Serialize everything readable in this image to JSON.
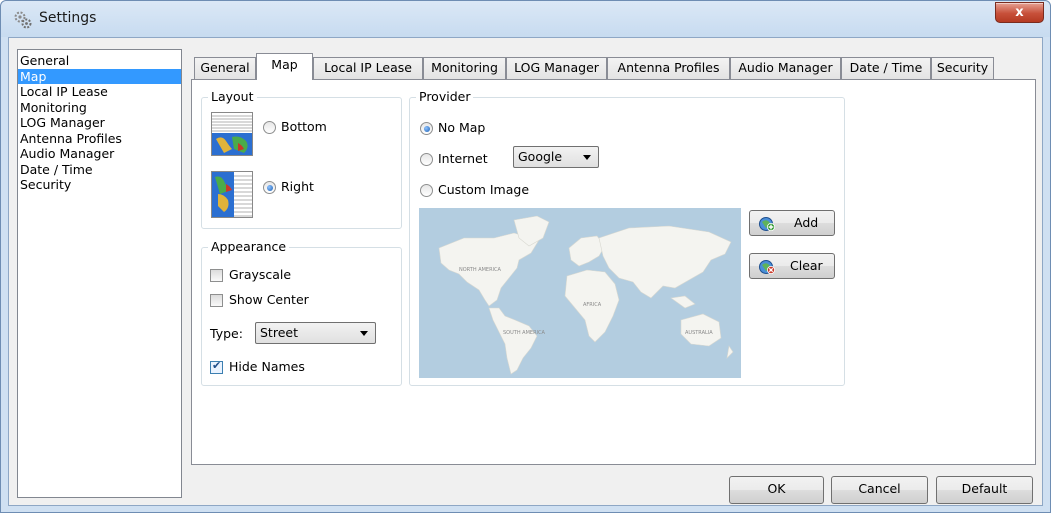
{
  "window": {
    "title": "Settings",
    "icons": {
      "app": "gear-icon",
      "close": "close-icon"
    },
    "close_glyph": "x"
  },
  "sidebar": {
    "items": [
      {
        "label": "General",
        "selected": false
      },
      {
        "label": "Map",
        "selected": true
      },
      {
        "label": "Local IP Lease",
        "selected": false
      },
      {
        "label": "Monitoring",
        "selected": false
      },
      {
        "label": "LOG Manager",
        "selected": false
      },
      {
        "label": "Antenna Profiles",
        "selected": false
      },
      {
        "label": "Audio Manager",
        "selected": false
      },
      {
        "label": "Date / Time",
        "selected": false
      },
      {
        "label": "Security",
        "selected": false
      }
    ]
  },
  "tabs": [
    {
      "label": "General",
      "active": false
    },
    {
      "label": "Map",
      "active": true
    },
    {
      "label": "Local IP Lease",
      "active": false
    },
    {
      "label": "Monitoring",
      "active": false
    },
    {
      "label": "LOG Manager",
      "active": false
    },
    {
      "label": "Antenna Profiles",
      "active": false
    },
    {
      "label": "Audio Manager",
      "active": false
    },
    {
      "label": "Date / Time",
      "active": false
    },
    {
      "label": "Security",
      "active": false
    }
  ],
  "layout_group": {
    "title": "Layout",
    "bottom_label": "Bottom",
    "bottom_checked": false,
    "right_label": "Right",
    "right_checked": true
  },
  "appearance_group": {
    "title": "Appearance",
    "grayscale_label": "Grayscale",
    "grayscale_checked": false,
    "show_center_label": "Show Center",
    "show_center_checked": false,
    "type_label": "Type:",
    "type_value": "Street",
    "hide_names_label": "Hide Names",
    "hide_names_checked": true
  },
  "provider_group": {
    "title": "Provider",
    "no_map_label": "No Map",
    "no_map_checked": true,
    "internet_label": "Internet",
    "internet_checked": false,
    "internet_provider": "Google",
    "custom_image_label": "Custom Image",
    "custom_image_checked": false,
    "add_label": "Add",
    "clear_label": "Clear",
    "add_icon": "globe-add-icon",
    "clear_icon": "globe-remove-icon",
    "map_labels": {
      "north_america": "NORTH AMERICA",
      "south_america": "SOUTH AMERICA",
      "africa": "AFRICA",
      "australia": "AUSTRALIA"
    }
  },
  "footer": {
    "ok_label": "OK",
    "cancel_label": "Cancel",
    "default_label": "Default"
  },
  "colors": {
    "selection": "#3399ff",
    "titlebar": "#c7dbf0",
    "close_button": "#c7503a",
    "map_water": "#b3cde0"
  }
}
